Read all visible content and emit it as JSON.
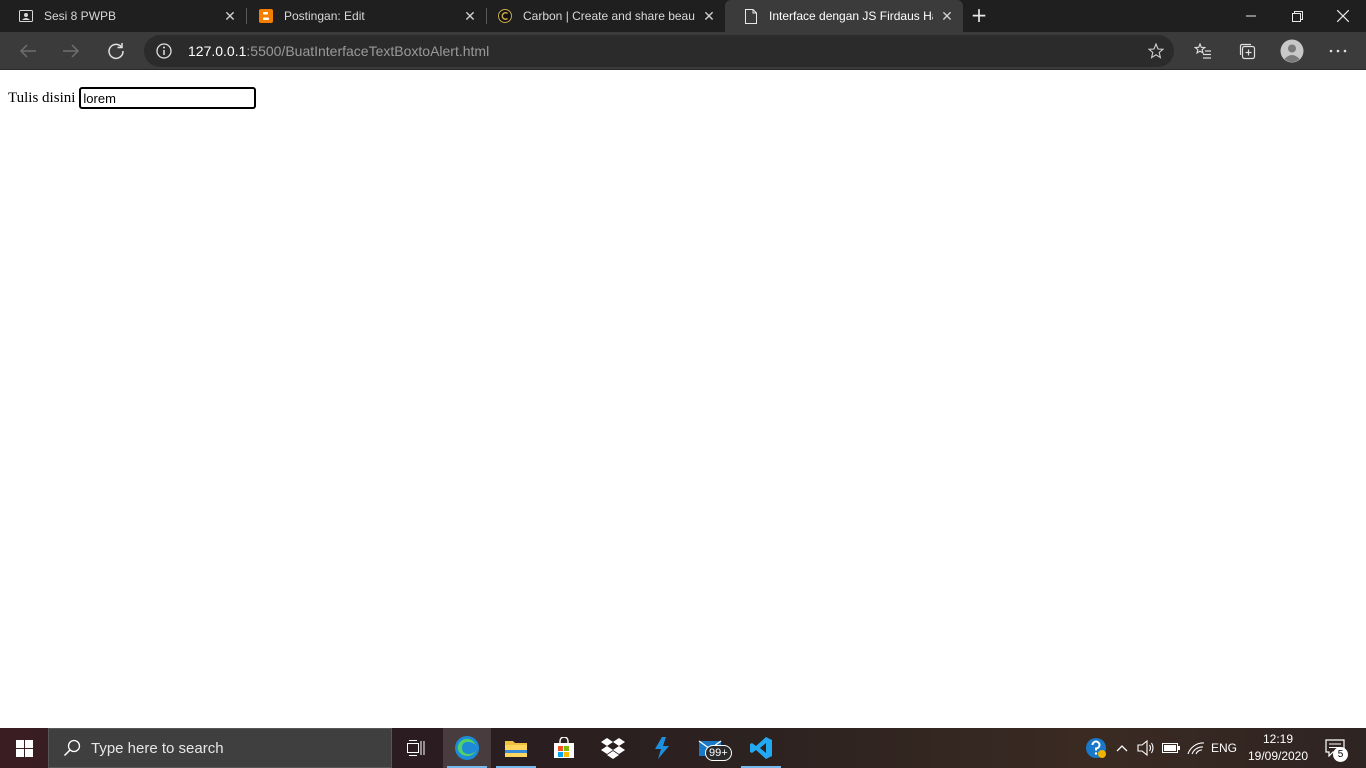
{
  "browser": {
    "tabs": [
      {
        "title": "Sesi 8 PWPB",
        "icon": "contact-card-icon",
        "active": false
      },
      {
        "title": "Postingan: Edit",
        "icon": "blogger-icon",
        "active": false
      },
      {
        "title": "Carbon | Create and share beauti",
        "icon": "carbon-icon",
        "active": false
      },
      {
        "title": "Interface dengan JS Firdaus Haqi",
        "icon": "page-icon",
        "active": true
      }
    ],
    "new_tab_label": "+",
    "address_bar": {
      "host": "127.0.0.1",
      "path": ":5500/BuatInterfaceTextBoxtoAlert.html"
    }
  },
  "page": {
    "label": "Tulis disini",
    "input_value": "lorem"
  },
  "taskbar": {
    "search_placeholder": "Type here to search",
    "mail_badge": "99+",
    "language": "ENG",
    "time": "12:19",
    "date": "19/09/2020",
    "notification_count": "5",
    "accent_color": "#76b9ed"
  }
}
